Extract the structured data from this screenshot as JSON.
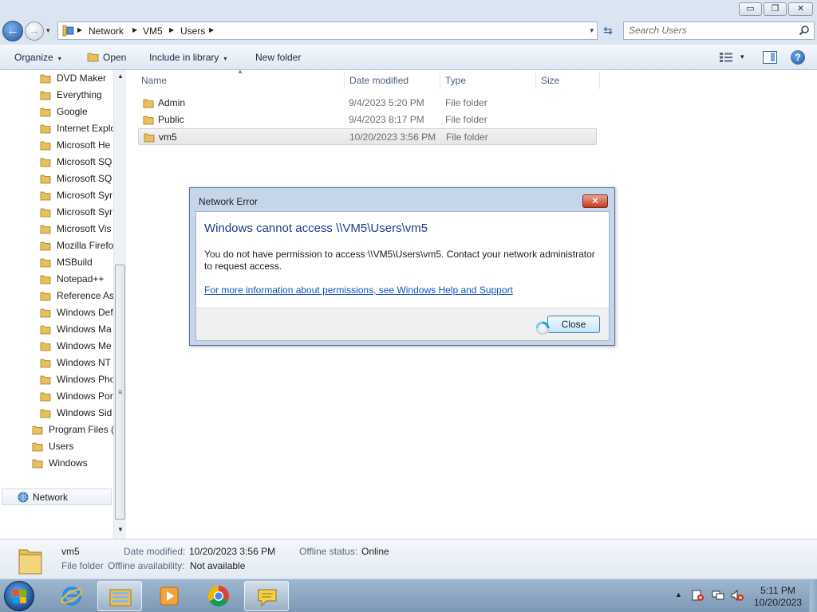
{
  "titlebar": {
    "minimize_glyph": "▭",
    "maximize_glyph": "❐",
    "close_glyph": "✕"
  },
  "navigation": {
    "back_glyph": "←",
    "forward_glyph": "→",
    "recent_glyph": "▾",
    "breadcrumb": [
      "Network",
      "VM5",
      "Users"
    ],
    "separator_glyph": "▶",
    "dropdown_glyph": "▾",
    "refresh_glyph": "⇆",
    "search_placeholder": "Search Users"
  },
  "toolbar": {
    "organize": "Organize",
    "open": "Open",
    "include_in_library": "Include in library",
    "new_folder": "New folder",
    "dropdown_glyph": "▾",
    "help_glyph": "?"
  },
  "tree": {
    "items": [
      {
        "label": "DVD Maker",
        "indent": 1
      },
      {
        "label": "Everything",
        "indent": 1
      },
      {
        "label": "Google",
        "indent": 1
      },
      {
        "label": "Internet Explo",
        "indent": 1
      },
      {
        "label": "Microsoft He",
        "indent": 1
      },
      {
        "label": "Microsoft SQ",
        "indent": 1
      },
      {
        "label": "Microsoft SQ",
        "indent": 1
      },
      {
        "label": "Microsoft Syr",
        "indent": 1
      },
      {
        "label": "Microsoft Syr",
        "indent": 1
      },
      {
        "label": "Microsoft Vis",
        "indent": 1
      },
      {
        "label": "Mozilla Firefo",
        "indent": 1
      },
      {
        "label": "MSBuild",
        "indent": 1
      },
      {
        "label": "Notepad++",
        "indent": 1
      },
      {
        "label": "Reference As",
        "indent": 1
      },
      {
        "label": "Windows Def",
        "indent": 1
      },
      {
        "label": "Windows Ma",
        "indent": 1
      },
      {
        "label": "Windows Me",
        "indent": 1
      },
      {
        "label": "Windows NT",
        "indent": 1
      },
      {
        "label": "Windows Pho",
        "indent": 1
      },
      {
        "label": "Windows Por",
        "indent": 1
      },
      {
        "label": "Windows Sid",
        "indent": 1
      },
      {
        "label": "Program Files (",
        "indent": 0
      },
      {
        "label": "Users",
        "indent": 0
      },
      {
        "label": "Windows",
        "indent": 0
      }
    ],
    "network_label": "Network",
    "scroll_up_glyph": "▲",
    "scroll_down_glyph": "▼",
    "scroll_grip_glyph": "≡"
  },
  "filelist": {
    "columns": {
      "name": "Name",
      "date": "Date modified",
      "type": "Type",
      "size": "Size"
    },
    "sort_glyph": "▲",
    "rows": [
      {
        "name": "Admin",
        "date": "9/4/2023 5:20 PM",
        "type": "File folder"
      },
      {
        "name": "Public",
        "date": "9/4/2023 8:17 PM",
        "type": "File folder"
      },
      {
        "name": "vm5",
        "date": "10/20/2023 3:56 PM",
        "type": "File folder",
        "selected": true
      }
    ]
  },
  "details": {
    "name": "vm5",
    "kind": "File folder",
    "date_label": "Date modified:",
    "date_value": "10/20/2023 3:56 PM",
    "offline_status_label": "Offline status:",
    "offline_status_value": "Online",
    "offline_availability_label": "Offline availability:",
    "offline_availability_value": "Not available"
  },
  "dialog": {
    "title": "Network Error",
    "close_glyph": "✕",
    "heading": "Windows cannot access \\\\VM5\\Users\\vm5",
    "message_line1": "You do not have permission to access \\\\VM5\\Users\\vm5. Contact your network administrator",
    "message_line2": "to request access.",
    "link": "For more information about permissions, see Windows Help and Support",
    "close_button": "Close"
  },
  "taskbar": {
    "tray_up_glyph": "▲",
    "time": "5:11 PM",
    "date": "10/20/2023"
  },
  "colors": {
    "accent": "#1a3e85",
    "link": "#0d55c1",
    "folder": "#e8c05a",
    "dialog_close": "#c43c22"
  },
  "icons": {
    "folder": "folder-icon",
    "network": "network-icon",
    "search": "search-icon",
    "help": "help-icon"
  }
}
